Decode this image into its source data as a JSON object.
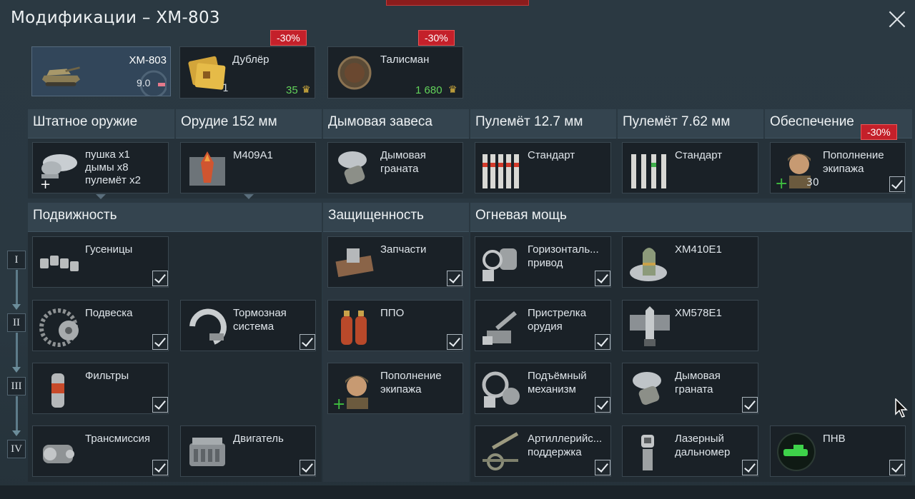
{
  "window": {
    "title": "Модификации – XM-803"
  },
  "crew": {
    "vehicle": {
      "name": "XM-803",
      "br": "9.0"
    },
    "backup": {
      "label": "Дублёр",
      "count": "1",
      "cost": "35",
      "discount": "-30%"
    },
    "talisman": {
      "label": "Талисман",
      "cost": "1 680",
      "discount": "-30%"
    }
  },
  "weapon_headers": [
    "Штатное оружие",
    "Орудие 152 мм",
    "Дымовая завеса",
    "Пулемёт 12.7 мм",
    "Пулемёт 7.62 мм",
    "Обеспечение"
  ],
  "weapons": {
    "stock": {
      "line1": "пушка x1",
      "line2": "дымы x8",
      "line3": "пулемёт x2"
    },
    "gun": {
      "label": "M409A1"
    },
    "smoke": {
      "label": "Дымовая граната"
    },
    "mg127": {
      "label": "Стандарт"
    },
    "mg762": {
      "label": "Стандарт"
    },
    "support": {
      "label": "Пополнение экипажа",
      "count": "30",
      "discount": "-30%"
    }
  },
  "sections": {
    "mobility": "Подвижность",
    "protection": "Защищенность",
    "firepower": "Огневая мощь"
  },
  "tiers": [
    "I",
    "II",
    "III",
    "IV"
  ],
  "mods": {
    "tracks": "Гусеницы",
    "suspension": "Подвеска",
    "brakes": "Тормозная система",
    "filters": "Фильтры",
    "transmission": "Трансмиссия",
    "engine": "Двигатель",
    "parts": "Запчасти",
    "fpe": "ППО",
    "crew_replen": "Пополнение экипажа",
    "horiz_drive": "Горизонталь... привод",
    "xm410": "XM410E1",
    "adjustment": "Пристрелка орудия",
    "xm578": "XM578E1",
    "elevation": "Подъёмный механизм",
    "smoke_grenade": "Дымовая граната",
    "artillery": "Артиллерийс... поддержка",
    "rangefinder": "Лазерный дальномер",
    "nvd": "ПНВ"
  },
  "colors": {
    "accent_green": "#62d25a",
    "discount_red": "#c4202a",
    "selected_bg": "#32465a"
  }
}
